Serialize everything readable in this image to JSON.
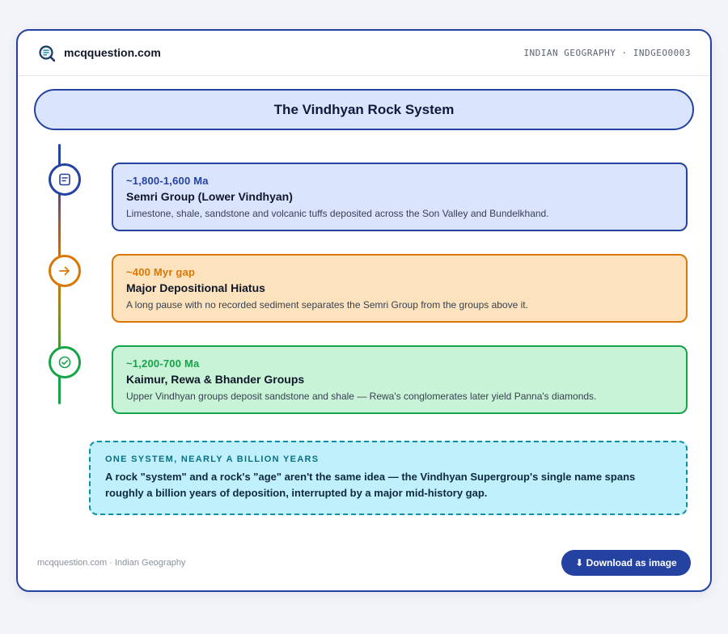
{
  "brand": {
    "name": "mcqquestion.com",
    "logo_icon": "magnifier-document-icon"
  },
  "header": {
    "meta": "INDIAN GEOGRAPHY · INDGEO0003"
  },
  "title": "The Vindhyan Rock System",
  "timeline": [
    {
      "date": "~1,800-1,600 Ma",
      "name": "Semri Group (Lower Vindhyan)",
      "desc": "Limestone, shale, sandstone and volcanic tuffs deposited across the Son Valley and Bundelkhand.",
      "icon": "document-icon",
      "accent": "#2442a0",
      "bg": "#dbe4fd"
    },
    {
      "date": "~400 Myr gap",
      "name": "Major Depositional Hiatus",
      "desc": "A long pause with no recorded sediment separates the Semri Group from the groups above it.",
      "icon": "arrow-right-icon",
      "accent": "#d97706",
      "bg": "#fde3bd"
    },
    {
      "date": "~1,200-700 Ma",
      "name": "Kaimur, Rewa & Bhander Groups",
      "desc": "Upper Vindhyan groups deposit sandstone and shale — Rewa's conglomerates later yield Panna's diamonds.",
      "icon": "check-circle-icon",
      "accent": "#16a34a",
      "bg": "#c9f3d6"
    }
  ],
  "note": {
    "kicker": "ONE SYSTEM, NEARLY A BILLION YEARS",
    "body": "A rock \"system\" and a rock's \"age\" aren't the same idea — the Vindhyan Supergroup's single name spans roughly a billion years of deposition, interrupted by a major mid-history gap."
  },
  "footer": {
    "text": "mcqquestion.com · Indian Geography",
    "download_label": "⬇ Download as image"
  }
}
